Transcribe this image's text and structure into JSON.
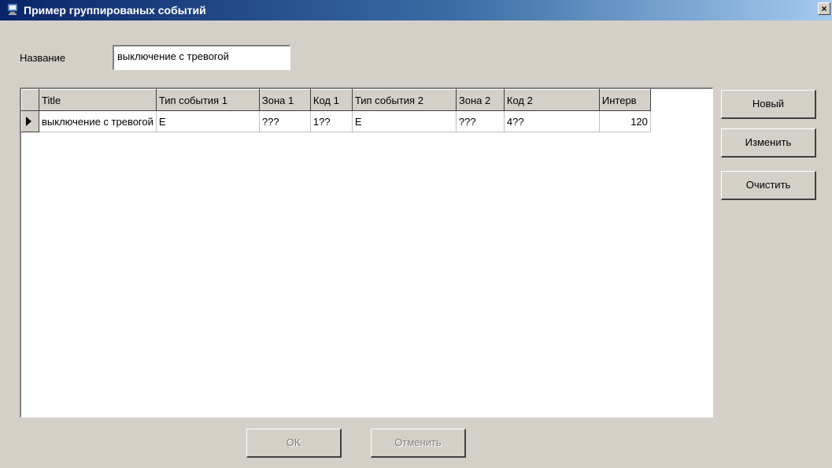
{
  "window": {
    "title": "Пример группированых событий",
    "close_label": "×"
  },
  "form": {
    "name_label": "Название",
    "name_value": "выключение с тревогой"
  },
  "grid": {
    "columns": [
      "Title",
      "Тип события 1",
      "Зона 1",
      "Код 1",
      "Тип события 2",
      "Зона 2",
      "Код 2",
      "Интерв"
    ],
    "rows": [
      [
        "выключение с тревогой",
        "E",
        "???",
        "1??",
        "E",
        "???",
        "4??",
        "120"
      ]
    ]
  },
  "side_buttons": {
    "new": "Новый",
    "edit": "Изменить",
    "clear": "Очистить"
  },
  "footer_buttons": {
    "ok": "OK",
    "cancel": "Отменить"
  }
}
